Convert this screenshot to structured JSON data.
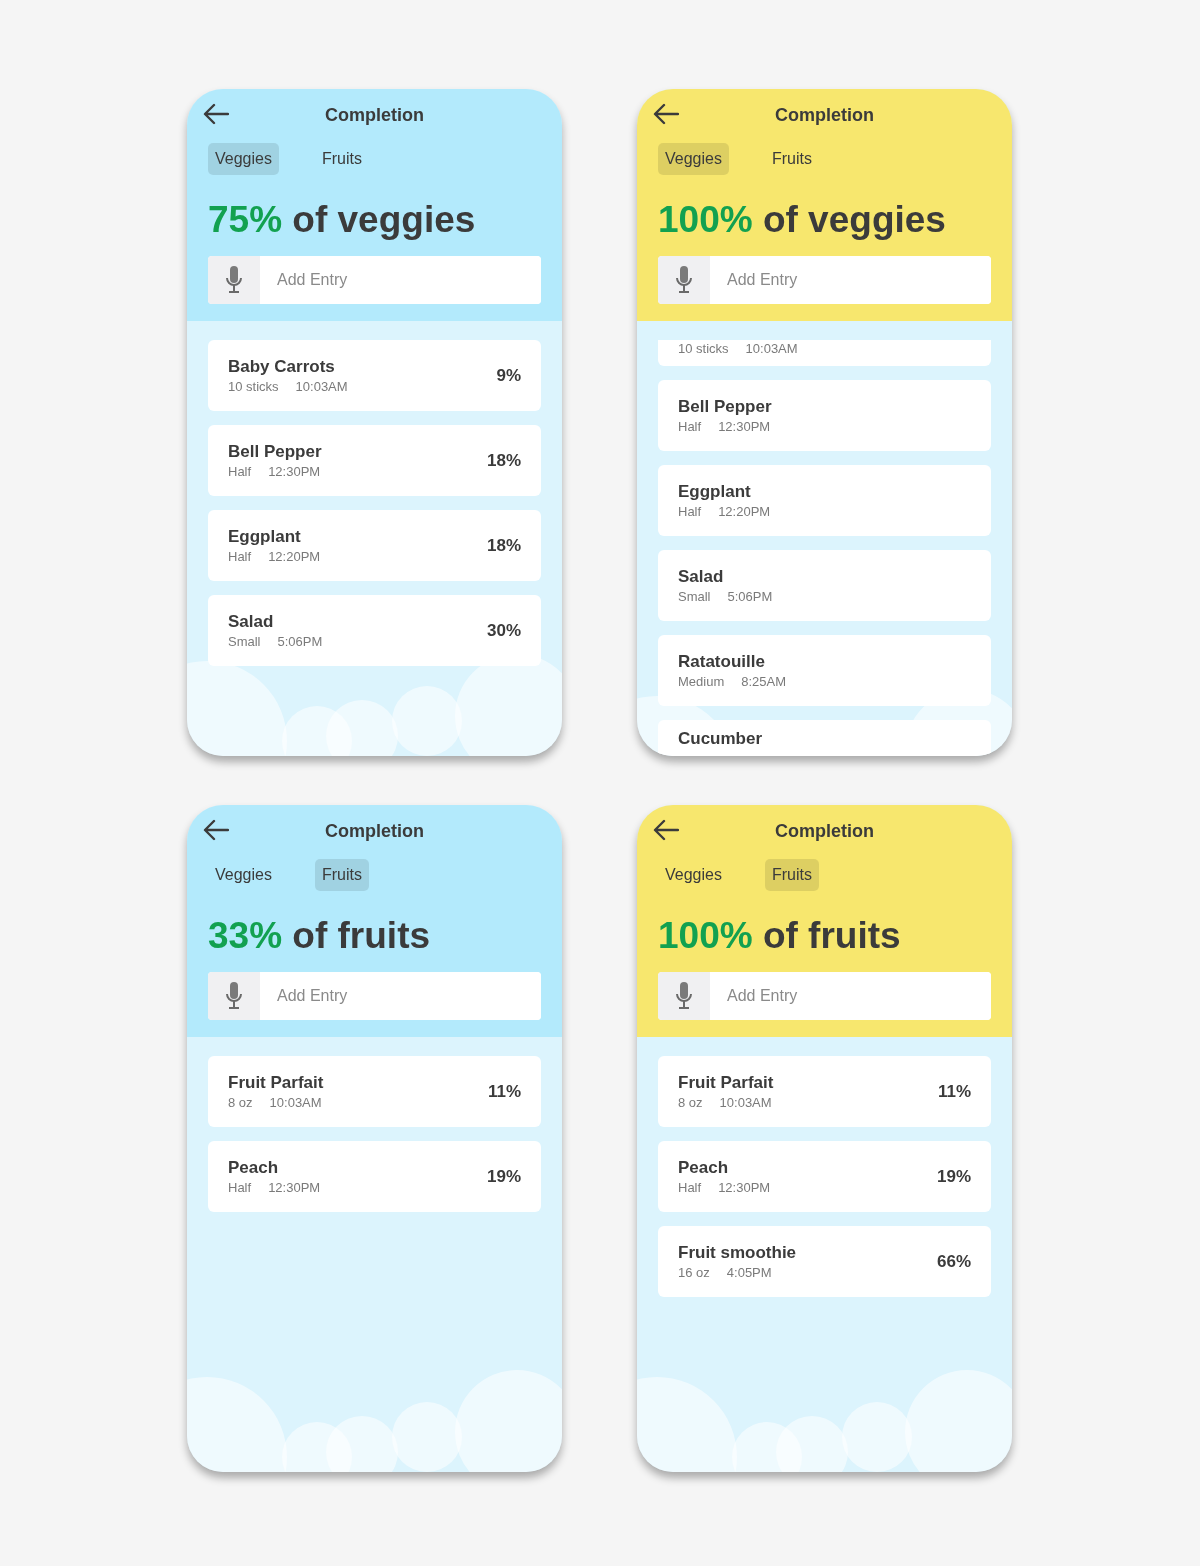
{
  "cards": [
    {
      "color": "#b3eafc",
      "title": "Completion",
      "tabs": [
        {
          "label": "Veggies",
          "selected": true
        },
        {
          "label": "Fruits",
          "selected": false
        }
      ],
      "headline": {
        "percent": "75%",
        "rest": "of veggies"
      },
      "entry": {
        "placeholder": "Add Entry"
      },
      "items": [
        {
          "kind": "full",
          "name": "Baby Carrots",
          "amount": "10 sticks",
          "time": "10:03AM",
          "percent": "9%"
        },
        {
          "kind": "full",
          "name": "Bell Pepper",
          "amount": "Half",
          "time": "12:30PM",
          "percent": "18%"
        },
        {
          "kind": "full",
          "name": "Eggplant",
          "amount": "Half",
          "time": "12:20PM",
          "percent": "18%"
        },
        {
          "kind": "full",
          "name": "Salad",
          "amount": "Small",
          "time": "5:06PM",
          "percent": "30%"
        }
      ]
    },
    {
      "color": "#f7e76e",
      "title": "Completion",
      "tabs": [
        {
          "label": "Veggies",
          "selected": true
        },
        {
          "label": "Fruits",
          "selected": false
        }
      ],
      "headline": {
        "percent": "100%",
        "rest": "of veggies"
      },
      "entry": {
        "placeholder": "Add Entry"
      },
      "items": [
        {
          "kind": "cut",
          "amount": "10 sticks",
          "time": "10:03AM"
        },
        {
          "kind": "full",
          "name": "Bell Pepper",
          "amount": "Half",
          "time": "12:30PM"
        },
        {
          "kind": "full",
          "name": "Eggplant",
          "amount": "Half",
          "time": "12:20PM"
        },
        {
          "kind": "full",
          "name": "Salad",
          "amount": "Small",
          "time": "5:06PM"
        },
        {
          "kind": "full",
          "name": "Ratatouille",
          "amount": "Medium",
          "time": "8:25AM"
        },
        {
          "kind": "full",
          "name": "Cucumber"
        }
      ]
    },
    {
      "color": "#b3eafc",
      "title": "Completion",
      "tabs": [
        {
          "label": "Veggies",
          "selected": false
        },
        {
          "label": "Fruits",
          "selected": true
        }
      ],
      "headline": {
        "percent": "33%",
        "rest": "of fruits"
      },
      "entry": {
        "placeholder": "Add Entry"
      },
      "items": [
        {
          "kind": "full",
          "name": "Fruit Parfait",
          "amount": "8 oz",
          "time": "10:03AM",
          "percent": "11%"
        },
        {
          "kind": "full",
          "name": "Peach",
          "amount": "Half",
          "time": "12:30PM",
          "percent": "19%"
        }
      ]
    },
    {
      "color": "#f7e76e",
      "title": "Completion",
      "tabs": [
        {
          "label": "Veggies",
          "selected": false
        },
        {
          "label": "Fruits",
          "selected": true
        }
      ],
      "headline": {
        "percent": "100%",
        "rest": "of fruits"
      },
      "entry": {
        "placeholder": "Add Entry"
      },
      "items": [
        {
          "kind": "full",
          "name": "Fruit Parfait",
          "amount": "8 oz",
          "time": "10:03AM",
          "percent": "11%"
        },
        {
          "kind": "full",
          "name": "Peach",
          "amount": "Half",
          "time": "12:30PM",
          "percent": "19%"
        },
        {
          "kind": "full",
          "name": "Fruit smoothie",
          "amount": "16 oz",
          "time": "4:05PM",
          "percent": "66%"
        }
      ]
    }
  ]
}
